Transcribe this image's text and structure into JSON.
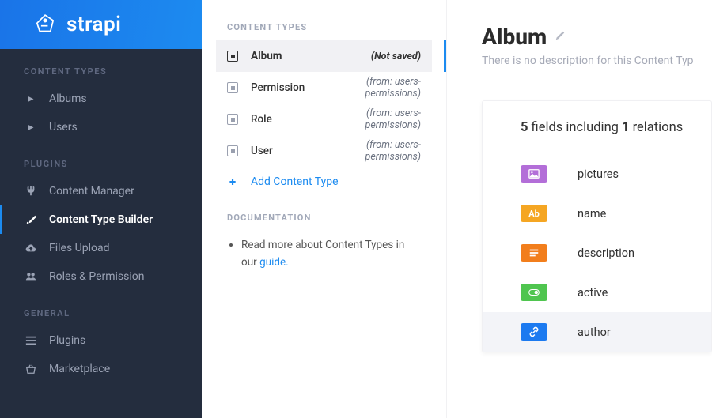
{
  "brand": {
    "name": "strapi"
  },
  "sidebar": {
    "section_content_types": "Content Types",
    "section_plugins": "Plugins",
    "section_general": "General",
    "ct_items": [
      {
        "label": "Albums"
      },
      {
        "label": "Users"
      }
    ],
    "plugins": [
      {
        "label": "Content Manager"
      },
      {
        "label": "Content Type Builder"
      },
      {
        "label": "Files Upload"
      },
      {
        "label": "Roles & Permission"
      }
    ],
    "general": [
      {
        "label": "Plugins"
      },
      {
        "label": "Marketplace"
      }
    ]
  },
  "mid": {
    "section_ct": "Content Types",
    "items": [
      {
        "name": "Album",
        "meta": "(Not saved)"
      },
      {
        "name": "Permission",
        "meta": "(from: users-permissions)"
      },
      {
        "name": "Role",
        "meta": "(from: users-permissions)"
      },
      {
        "name": "User",
        "meta": "(from: users-permissions)"
      }
    ],
    "add_label": "Add Content Type",
    "section_doc": "Documentation",
    "doc_text": "Read more about Content Types in our ",
    "doc_link": "guide."
  },
  "detail": {
    "title": "Album",
    "subtitle": "There is no description for this Content Typ",
    "fields_head_pre": "5",
    "fields_head_mid1": " fields including ",
    "fields_head_num2": "1",
    "fields_head_mid2": " relations",
    "fields": [
      {
        "name": "pictures"
      },
      {
        "name": "name"
      },
      {
        "name": "description"
      },
      {
        "name": "active"
      },
      {
        "name": "author"
      }
    ]
  }
}
